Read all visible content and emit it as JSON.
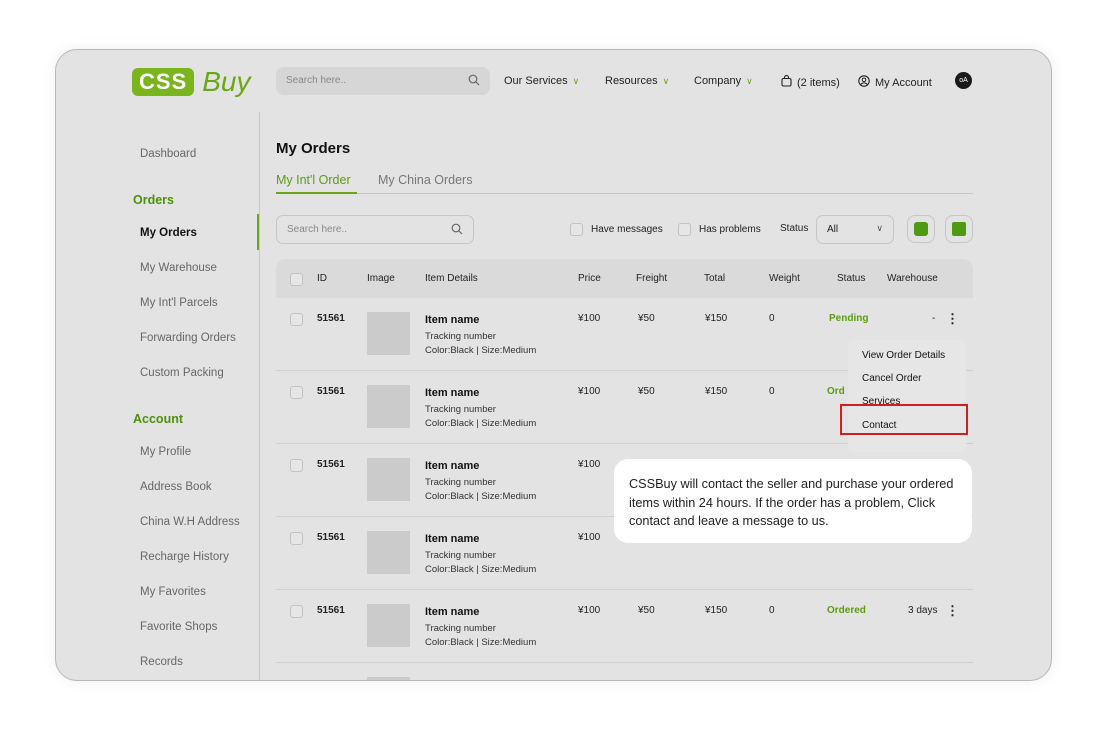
{
  "header": {
    "logo_box": "CSS",
    "logo_text": "Buy",
    "search_placeholder": "Search here..",
    "nav": [
      "Our Services",
      "Resources",
      "Company"
    ],
    "cart": "(2 items)",
    "account": "My Account",
    "avatar": "oA"
  },
  "sidebar": {
    "dashboard": "Dashboard",
    "orders_head": "Orders",
    "orders_items": [
      "My Orders",
      "My Warehouse",
      "My Int'l Parcels",
      "Forwarding Orders",
      "Custom Packing"
    ],
    "account_head": "Account",
    "account_items": [
      "My Profile",
      "Address Book",
      "China W.H Address",
      "Recharge History",
      "My Favorites",
      "Favorite Shops",
      "Records"
    ]
  },
  "main": {
    "title": "My Orders",
    "tabs": [
      "My Int'l Order",
      "My China Orders"
    ],
    "search_placeholder": "Search here..",
    "filter_messages": "Have messages",
    "filter_problems": "Has problems",
    "status_label": "Status",
    "status_value": "All",
    "columns": [
      "ID",
      "Image",
      "Item Details",
      "Price",
      "Freight",
      "Total",
      "Weight",
      "Status",
      "Warehouse"
    ],
    "rows": [
      {
        "id": "51561",
        "name": "Item name",
        "tracking": "Tracking number",
        "attrs": "Color:Black | Size:Medium",
        "price": "¥100",
        "freight": "¥50",
        "total": "¥150",
        "weight": "0",
        "status": "Pending",
        "warehouse": "-"
      },
      {
        "id": "51561",
        "name": "Item name",
        "tracking": "Tracking number",
        "attrs": "Color:Black | Size:Medium",
        "price": "¥100",
        "freight": "¥50",
        "total": "¥150",
        "weight": "0",
        "status": "Ord",
        "warehouse": ""
      },
      {
        "id": "51561",
        "name": "Item name",
        "tracking": "Tracking number",
        "attrs": "Color:Black | Size:Medium",
        "price": "¥100",
        "freight": "",
        "total": "",
        "weight": "",
        "status": "",
        "warehouse": ""
      },
      {
        "id": "51561",
        "name": "Item name",
        "tracking": "Tracking number",
        "attrs": "Color:Black | Size:Medium",
        "price": "¥100",
        "freight": "",
        "total": "",
        "weight": "",
        "status": "",
        "warehouse": ""
      },
      {
        "id": "51561",
        "name": "Item name",
        "tracking": "Tracking number",
        "attrs": "Color:Black | Size:Medium",
        "price": "¥100",
        "freight": "¥50",
        "total": "¥150",
        "weight": "0",
        "status": "Ordered",
        "warehouse": "3 days"
      }
    ],
    "menu": [
      "View Order Details",
      "Cancel Order",
      "Services",
      "Contact"
    ],
    "tooltip": "CSSBuy will contact the seller and purchase your ordered items within 24 hours. If the order has a problem, Click contact and leave a message to us."
  }
}
